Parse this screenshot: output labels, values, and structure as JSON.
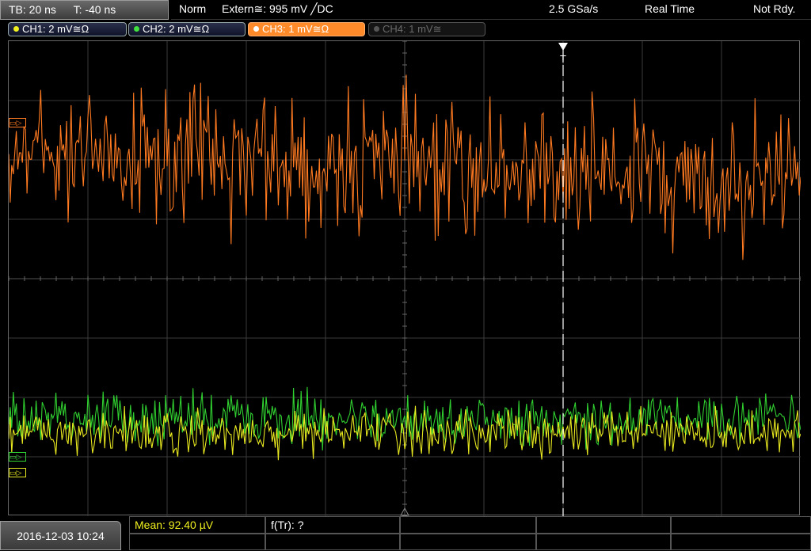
{
  "timebase": {
    "tb": "TB: 20 ns",
    "trig_time": "T: -40 ns"
  },
  "status": {
    "mode": "Norm",
    "trigger": "Extern≅: 995 mV ╱DC",
    "sample_rate": "2.5 GSa/s",
    "acq_mode": "Real Time",
    "state": "Not Rdy."
  },
  "channels": [
    {
      "label": "CH1: 2 mV≅Ω",
      "color": "#f0f020",
      "state": "on"
    },
    {
      "label": "CH2: 2 mV≅Ω",
      "color": "#40e040",
      "state": "on"
    },
    {
      "label": "CH3: 1 mV≅Ω",
      "color": "#ff8a2a",
      "state": "active"
    },
    {
      "label": "CH4: 1 mV≅",
      "color": "#666666",
      "state": "off"
    }
  ],
  "trigger_marker": "T",
  "datetime": "2016-12-03 10:24",
  "measurements": {
    "mean": "Mean: 92.40 µV",
    "ftr": "f(Tr): ?"
  },
  "colors": {
    "ch1": "#e8e820",
    "ch2": "#30d030",
    "ch3": "#ff7a20",
    "grid": "#444444"
  },
  "chart_data": {
    "type": "line",
    "grid": true,
    "divisions": {
      "x": 10,
      "y": 8
    },
    "series": [
      {
        "name": "CH3",
        "level_div": 1.8,
        "trend_div": 0.6,
        "noise_div": 0.9
      },
      {
        "name": "CH2",
        "level_div": 6.35,
        "trend_div": 0,
        "noise_div": 0.35
      },
      {
        "name": "CH1",
        "level_div": 6.6,
        "trend_div": 0,
        "noise_div": 0.3
      }
    ]
  }
}
